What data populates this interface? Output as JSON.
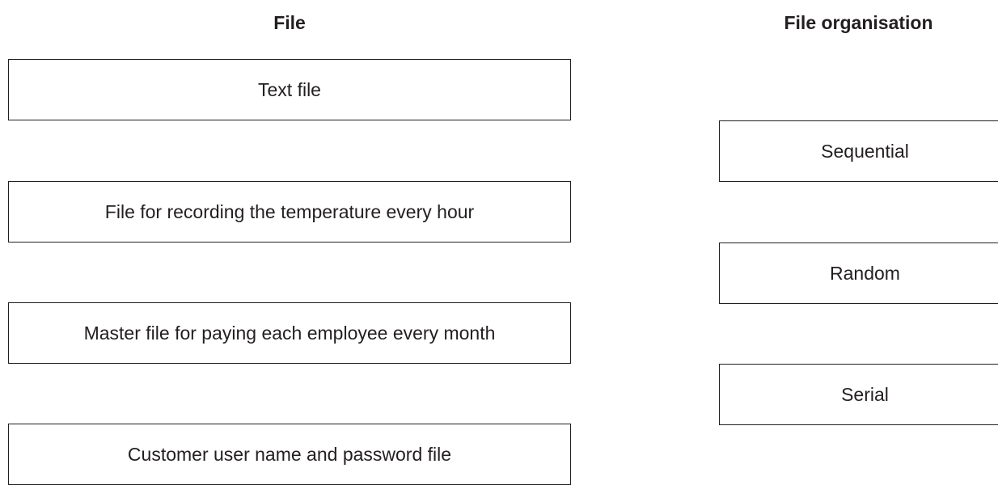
{
  "headings": {
    "file": "File",
    "file_organisation": "File organisation"
  },
  "files": [
    "Text file",
    "File for recording the temperature every hour",
    "Master file for paying each employee every month",
    "Customer user name and password file"
  ],
  "organisations": [
    "Sequential",
    "Random",
    "Serial"
  ]
}
